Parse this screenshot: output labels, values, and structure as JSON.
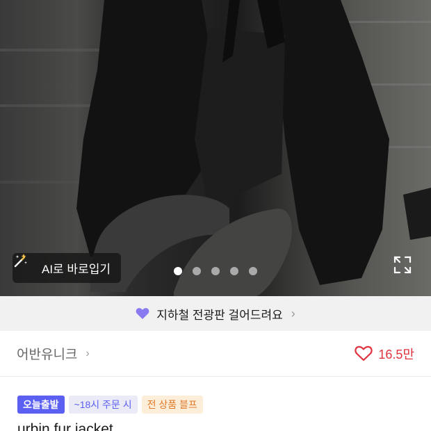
{
  "photo": {
    "ai_button_label": "AI로 바로입기",
    "ai_icon": "magic-wand-icon",
    "expand_icon": "expand-icon",
    "carousel": {
      "total": 5,
      "active_index": 0
    }
  },
  "banner": {
    "icon": "heart-icon",
    "text": "지하철 전광판 걸어드려요",
    "chevron": "›"
  },
  "brand": {
    "name": "어반유니크",
    "chevron": "›"
  },
  "likes": {
    "icon": "heart-outline-icon",
    "count": "16.5만"
  },
  "badges": {
    "today": "오늘출발",
    "order": "~18시 주문 시",
    "free": "전 상품 블프"
  },
  "product": {
    "name": "urbin fur jacket"
  },
  "colors": {
    "accent_purple": "#5b5ff2",
    "like_red": "#e0323f",
    "banner_bg": "#f1f1f1"
  }
}
